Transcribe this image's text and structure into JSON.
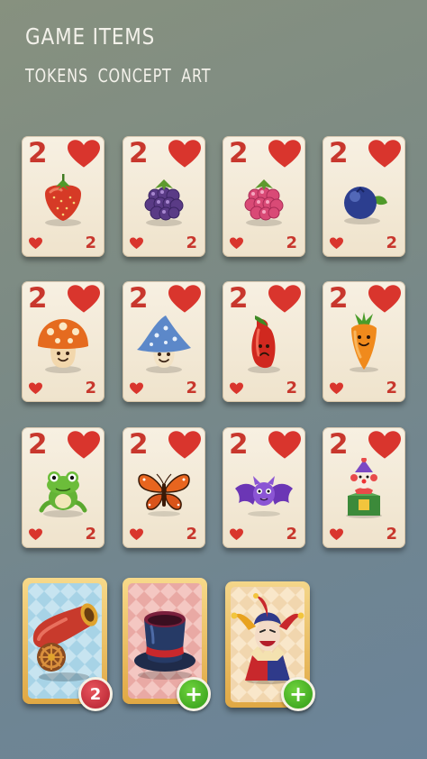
{
  "header": {
    "title": "GAME ITEMS",
    "subtitle": "TOKENS  CONCEPT ART"
  },
  "cards": [
    {
      "rank": "2",
      "item": "strawberry-icon"
    },
    {
      "rank": "2",
      "item": "blackberry-icon"
    },
    {
      "rank": "2",
      "item": "raspberry-icon"
    },
    {
      "rank": "2",
      "item": "blueberry-icon"
    },
    {
      "rank": "2",
      "item": "orange-mushroom-icon"
    },
    {
      "rank": "2",
      "item": "blue-mushroom-icon"
    },
    {
      "rank": "2",
      "item": "red-pepper-icon"
    },
    {
      "rank": "2",
      "item": "carrot-icon"
    },
    {
      "rank": "2",
      "item": "frog-icon"
    },
    {
      "rank": "2",
      "item": "butterfly-icon"
    },
    {
      "rank": "2",
      "item": "bat-icon"
    },
    {
      "rank": "2",
      "item": "jack-in-the-box-icon"
    }
  ],
  "specials": [
    {
      "item": "cannon-icon",
      "badge": "2"
    },
    {
      "item": "magic-hat-icon",
      "badge": "+"
    },
    {
      "item": "joker-icon",
      "badge": "+"
    }
  ],
  "colors": {
    "suit_red": "#c8372d",
    "card_face": "#f7f0e2",
    "badge_red": "#c62a36",
    "badge_green": "#3fae1f",
    "special_frame": "#e9b85a"
  }
}
